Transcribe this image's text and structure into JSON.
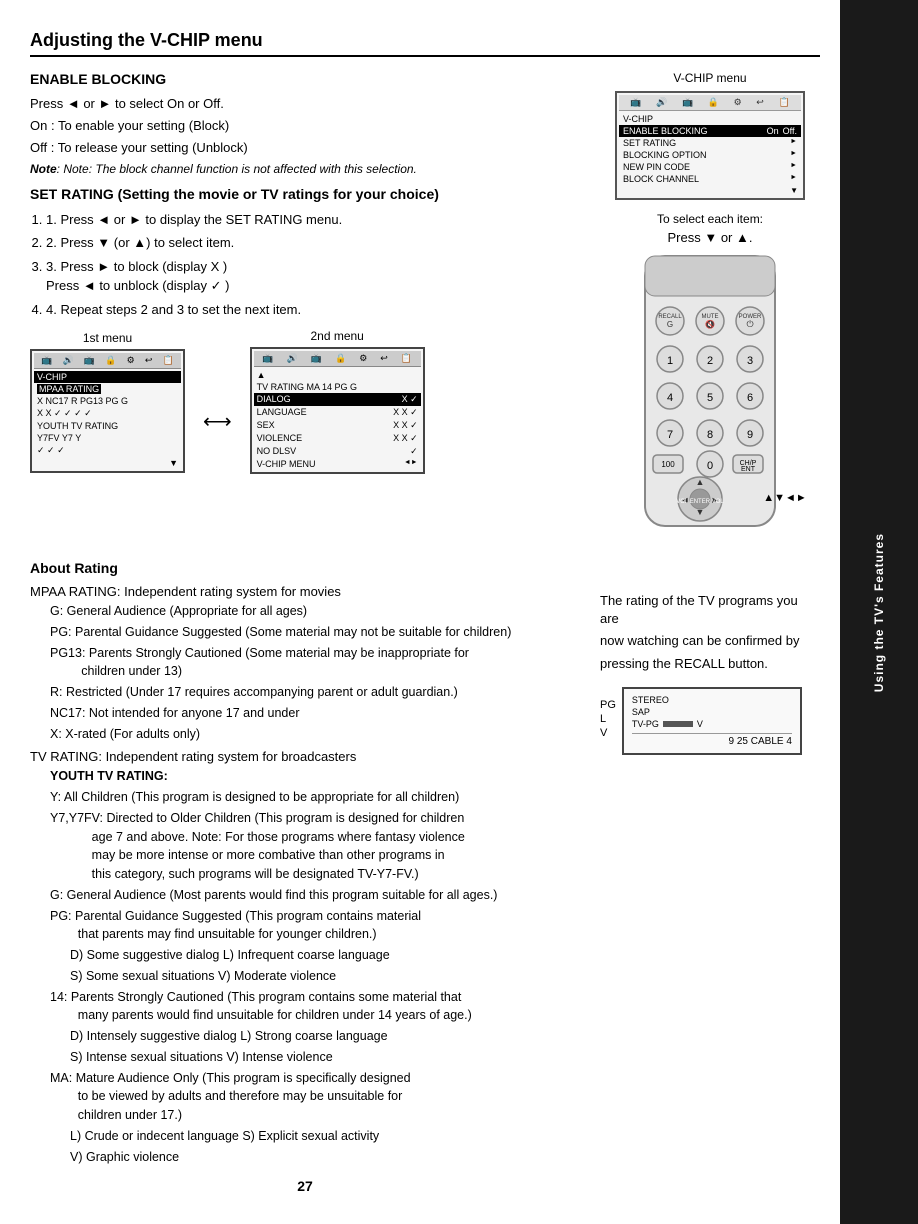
{
  "page": {
    "title": "Adjusting the V-CHIP menu",
    "page_number": "27"
  },
  "sidebar": {
    "label": "Using the TV's Features"
  },
  "enable_blocking": {
    "title": "ENABLE BLOCKING",
    "line1": "Press ◄ or ► to select On or Off.",
    "line2": "On : To enable your setting (Block)",
    "line3": "Off : To release your setting (Unblock)",
    "note": "Note: The block channel function is not affected with this selection."
  },
  "set_rating": {
    "title": "SET RATING (Setting the movie or TV ratings for your choice)",
    "step1": "1. Press ◄ or ► to display the SET RATING menu.",
    "step2": "2. Press ▼ (or ▲) to select item.",
    "step3a": "3. Press ► to block (display X )",
    "step3b": "Press ◄ to unblock (display ✓ )",
    "step4": "4. Repeat steps 2 and 3 to set the next item."
  },
  "vchip_menu": {
    "label": "V-CHIP menu",
    "select_each": "To select each item:",
    "press_direction": "Press ▼ or ▲."
  },
  "first_menu": {
    "label": "1st menu",
    "title": "V-CHIP",
    "section": "MPAA RATING",
    "items": [
      "X  NC17  R  PG13  PG  G",
      "X    X    ✓   ✓    ✓   ✓",
      "YOUTH TV RATING",
      "Y7FV  Y7  Y"
    ]
  },
  "second_menu": {
    "label": "2nd menu",
    "header": "TV RATING  MA  14  PG  G",
    "items": [
      {
        "name": "DIALOG",
        "values": "X   ✓",
        "selected": true
      },
      {
        "name": "LANGUAGE",
        "values": "X   X   ✓",
        "selected": false
      },
      {
        "name": "SEX",
        "values": "X   X   ✓",
        "selected": false
      },
      {
        "name": "VIOLENCE",
        "values": "X   X   ✓",
        "selected": false
      },
      {
        "name": "NO DLSV",
        "values": "✓",
        "selected": false
      },
      {
        "name": "V-CHIP MENU",
        "values": "",
        "selected": false
      }
    ]
  },
  "about_rating": {
    "title": "About Rating",
    "mpaa_title": "MPAA RATING: Independent rating system for movies",
    "mpaa_items": [
      "G: General Audience (Appropriate for all ages)",
      "PG: Parental Guidance Suggested (Some material may not be suitable for children)",
      "PG13: Parents Strongly Cautioned (Some material may be inappropriate for children under 13)",
      "R: Restricted (Under 17 requires accompanying parent or adult guardian.)",
      "NC17: Not intended for anyone 17 and under",
      "X: X-rated (For adults only)"
    ],
    "tv_title": "TV RATING: Independent rating system for broadcasters",
    "youth_title": "YOUTH TV RATING:",
    "youth_items": [
      "Y: All Children (This program is designed to be appropriate for all children)",
      "Y7,Y7FV: Directed to Older Children (This program is designed for children age 7 and above. Note: For those programs where fantasy violence may be more intense or more combative than other programs in this category, such programs will be designated TV-Y7-FV.)",
      "G: General Audience (Most parents would find this program suitable for all ages.)",
      "PG: Parental Guidance Suggested (This program contains material that parents may find unsuitable for younger children.)",
      "D) Some suggestive dialog  L) Infrequent coarse language",
      "S) Some sexual situations  V) Moderate violence",
      "14: Parents Strongly Cautioned (This program contains some material that many parents would find unsuitable for children under 14 years of age.)",
      "D) Intensely suggestive dialog  L) Strong coarse language",
      "S) Intense sexual situations  V) Intense violence",
      "MA: Mature Audience Only (This program is specifically designed to be viewed by adults and therefore may be unsuitable for children under 17.)",
      "L) Crude or indecent language  S) Explicit sexual activity",
      "V) Graphic violence"
    ]
  },
  "recall_text": {
    "line1": "The rating of the TV programs you are",
    "line2": "now watching can be confirmed by",
    "line3": "pressing the RECALL button."
  },
  "tv_display": {
    "pg_label": "PG",
    "l_label": "L",
    "v_label": "V",
    "stereo_label": "STEREO",
    "sap_label": "SAP",
    "tv_pg_label": "TV-PG",
    "bottom": "9  25  CABLE    4"
  }
}
